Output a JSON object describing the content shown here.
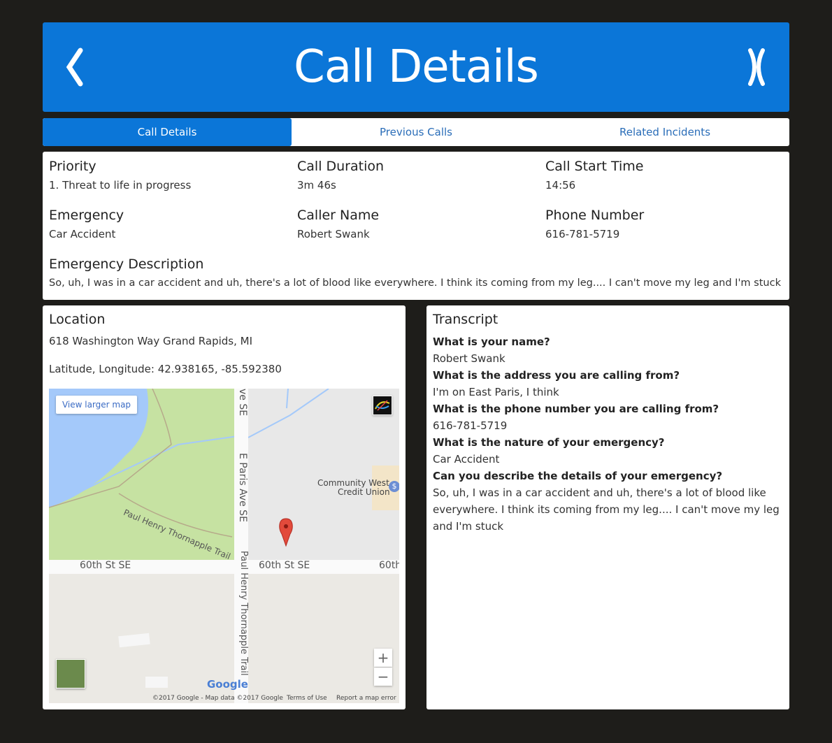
{
  "header": {
    "title": "Call Details",
    "back_glyph": "❮",
    "close_glyph": "X"
  },
  "tabs": [
    {
      "label": "Call Details",
      "active": true
    },
    {
      "label": "Previous Calls",
      "active": false
    },
    {
      "label": "Related Incidents",
      "active": false
    }
  ],
  "details": {
    "priority": {
      "label": "Priority",
      "value": "1. Threat to life in progress"
    },
    "duration": {
      "label": "Call Duration",
      "value": "3m 46s"
    },
    "start": {
      "label": "Call Start Time",
      "value": "14:56"
    },
    "emergency": {
      "label": "Emergency",
      "value": "Car Accident"
    },
    "caller": {
      "label": "Caller Name",
      "value": "Robert Swank"
    },
    "phone": {
      "label": "Phone Number",
      "value": "616-781-5719"
    },
    "description": {
      "label": "Emergency Description",
      "value": "So, uh, I was in a car accident and uh, there's a lot of blood like everywhere. I think its coming from my leg.... I can't move my leg and I'm stuck"
    }
  },
  "location": {
    "title": "Location",
    "address": "618 Washington Way Grand Rapids, MI",
    "coords": "Latitude, Longitude: 42.938165, -85.592380",
    "map": {
      "larger_map": "View larger map",
      "labels": {
        "street_top": "ve SE",
        "street_vertical": "E Paris Ave SE",
        "bank": "Community West",
        "bank2": "Credit Union",
        "trail": "Paul Henry Thornapple Trail",
        "sixtieth_left": "60th St SE",
        "sixtieth_mid": "60th St SE",
        "sixtieth_right": "60th",
        "trail_vertical": "Paul Henry Thornapple Trail"
      },
      "zoom_in": "+",
      "zoom_out": "−",
      "google": "Google",
      "footer": {
        "copyright": "©2017 Google - Map data ©2017 Google",
        "terms": "Terms of Use",
        "report": "Report a map error"
      }
    }
  },
  "transcript": {
    "title": "Transcript",
    "items": [
      {
        "q": "What is your name?",
        "a": "Robert Swank"
      },
      {
        "q": "What is the address you are calling from?",
        "a": "I'm on East Paris, I think"
      },
      {
        "q": "What is the phone number you are calling from?",
        "a": "616-781-5719"
      },
      {
        "q": "What is the nature of your emergency?",
        "a": "Car Accident"
      },
      {
        "q": "Can you describe the details of your emergency?",
        "a": "So, uh, I was in a car accident and uh, there's a lot of blood like everywhere. I think its coming from my leg.... I can't move my leg and I'm stuck"
      }
    ]
  },
  "colors": {
    "accent": "#0b76d8",
    "background": "#1e1d1a",
    "link": "#2a6db8"
  }
}
